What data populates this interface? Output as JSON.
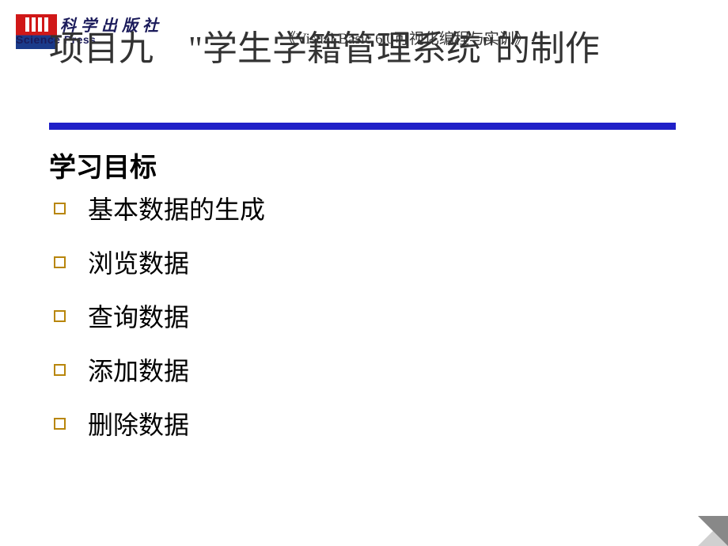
{
  "logo": {
    "cn_text": "科学出版社",
    "en_text": "Science Press"
  },
  "header": {
    "subtitle": "《Visual Basic 6.0可视化编程与实训》"
  },
  "title": "项目九　\"学生学籍管理系统\"的制作",
  "section_heading": "学习目标",
  "bullets": [
    "基本数据的生成",
    "浏览数据",
    "查询数据",
    "添加数据",
    "删除数据"
  ]
}
